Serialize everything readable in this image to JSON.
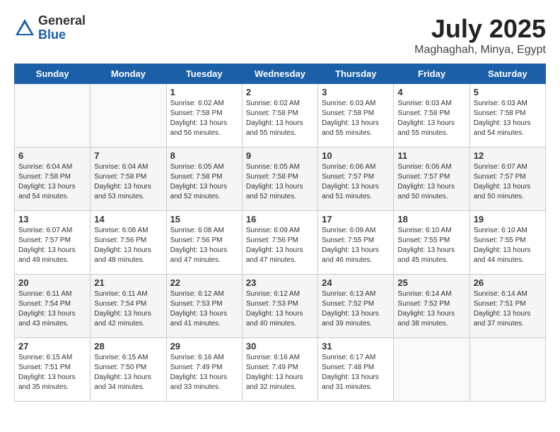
{
  "logo": {
    "general": "General",
    "blue": "Blue"
  },
  "title": "July 2025",
  "location": "Maghaghah, Minya, Egypt",
  "headers": [
    "Sunday",
    "Monday",
    "Tuesday",
    "Wednesday",
    "Thursday",
    "Friday",
    "Saturday"
  ],
  "weeks": [
    [
      {
        "day": "",
        "info": ""
      },
      {
        "day": "",
        "info": ""
      },
      {
        "day": "1",
        "info": "Sunrise: 6:02 AM\nSunset: 7:58 PM\nDaylight: 13 hours\nand 56 minutes."
      },
      {
        "day": "2",
        "info": "Sunrise: 6:02 AM\nSunset: 7:58 PM\nDaylight: 13 hours\nand 55 minutes."
      },
      {
        "day": "3",
        "info": "Sunrise: 6:03 AM\nSunset: 7:58 PM\nDaylight: 13 hours\nand 55 minutes."
      },
      {
        "day": "4",
        "info": "Sunrise: 6:03 AM\nSunset: 7:58 PM\nDaylight: 13 hours\nand 55 minutes."
      },
      {
        "day": "5",
        "info": "Sunrise: 6:03 AM\nSunset: 7:58 PM\nDaylight: 13 hours\nand 54 minutes."
      }
    ],
    [
      {
        "day": "6",
        "info": "Sunrise: 6:04 AM\nSunset: 7:58 PM\nDaylight: 13 hours\nand 54 minutes."
      },
      {
        "day": "7",
        "info": "Sunrise: 6:04 AM\nSunset: 7:58 PM\nDaylight: 13 hours\nand 53 minutes."
      },
      {
        "day": "8",
        "info": "Sunrise: 6:05 AM\nSunset: 7:58 PM\nDaylight: 13 hours\nand 52 minutes."
      },
      {
        "day": "9",
        "info": "Sunrise: 6:05 AM\nSunset: 7:58 PM\nDaylight: 13 hours\nand 52 minutes."
      },
      {
        "day": "10",
        "info": "Sunrise: 6:06 AM\nSunset: 7:57 PM\nDaylight: 13 hours\nand 51 minutes."
      },
      {
        "day": "11",
        "info": "Sunrise: 6:06 AM\nSunset: 7:57 PM\nDaylight: 13 hours\nand 50 minutes."
      },
      {
        "day": "12",
        "info": "Sunrise: 6:07 AM\nSunset: 7:57 PM\nDaylight: 13 hours\nand 50 minutes."
      }
    ],
    [
      {
        "day": "13",
        "info": "Sunrise: 6:07 AM\nSunset: 7:57 PM\nDaylight: 13 hours\nand 49 minutes."
      },
      {
        "day": "14",
        "info": "Sunrise: 6:08 AM\nSunset: 7:56 PM\nDaylight: 13 hours\nand 48 minutes."
      },
      {
        "day": "15",
        "info": "Sunrise: 6:08 AM\nSunset: 7:56 PM\nDaylight: 13 hours\nand 47 minutes."
      },
      {
        "day": "16",
        "info": "Sunrise: 6:09 AM\nSunset: 7:56 PM\nDaylight: 13 hours\nand 47 minutes."
      },
      {
        "day": "17",
        "info": "Sunrise: 6:09 AM\nSunset: 7:55 PM\nDaylight: 13 hours\nand 46 minutes."
      },
      {
        "day": "18",
        "info": "Sunrise: 6:10 AM\nSunset: 7:55 PM\nDaylight: 13 hours\nand 45 minutes."
      },
      {
        "day": "19",
        "info": "Sunrise: 6:10 AM\nSunset: 7:55 PM\nDaylight: 13 hours\nand 44 minutes."
      }
    ],
    [
      {
        "day": "20",
        "info": "Sunrise: 6:11 AM\nSunset: 7:54 PM\nDaylight: 13 hours\nand 43 minutes."
      },
      {
        "day": "21",
        "info": "Sunrise: 6:11 AM\nSunset: 7:54 PM\nDaylight: 13 hours\nand 42 minutes."
      },
      {
        "day": "22",
        "info": "Sunrise: 6:12 AM\nSunset: 7:53 PM\nDaylight: 13 hours\nand 41 minutes."
      },
      {
        "day": "23",
        "info": "Sunrise: 6:12 AM\nSunset: 7:53 PM\nDaylight: 13 hours\nand 40 minutes."
      },
      {
        "day": "24",
        "info": "Sunrise: 6:13 AM\nSunset: 7:52 PM\nDaylight: 13 hours\nand 39 minutes."
      },
      {
        "day": "25",
        "info": "Sunrise: 6:14 AM\nSunset: 7:52 PM\nDaylight: 13 hours\nand 38 minutes."
      },
      {
        "day": "26",
        "info": "Sunrise: 6:14 AM\nSunset: 7:51 PM\nDaylight: 13 hours\nand 37 minutes."
      }
    ],
    [
      {
        "day": "27",
        "info": "Sunrise: 6:15 AM\nSunset: 7:51 PM\nDaylight: 13 hours\nand 35 minutes."
      },
      {
        "day": "28",
        "info": "Sunrise: 6:15 AM\nSunset: 7:50 PM\nDaylight: 13 hours\nand 34 minutes."
      },
      {
        "day": "29",
        "info": "Sunrise: 6:16 AM\nSunset: 7:49 PM\nDaylight: 13 hours\nand 33 minutes."
      },
      {
        "day": "30",
        "info": "Sunrise: 6:16 AM\nSunset: 7:49 PM\nDaylight: 13 hours\nand 32 minutes."
      },
      {
        "day": "31",
        "info": "Sunrise: 6:17 AM\nSunset: 7:48 PM\nDaylight: 13 hours\nand 31 minutes."
      },
      {
        "day": "",
        "info": ""
      },
      {
        "day": "",
        "info": ""
      }
    ]
  ]
}
